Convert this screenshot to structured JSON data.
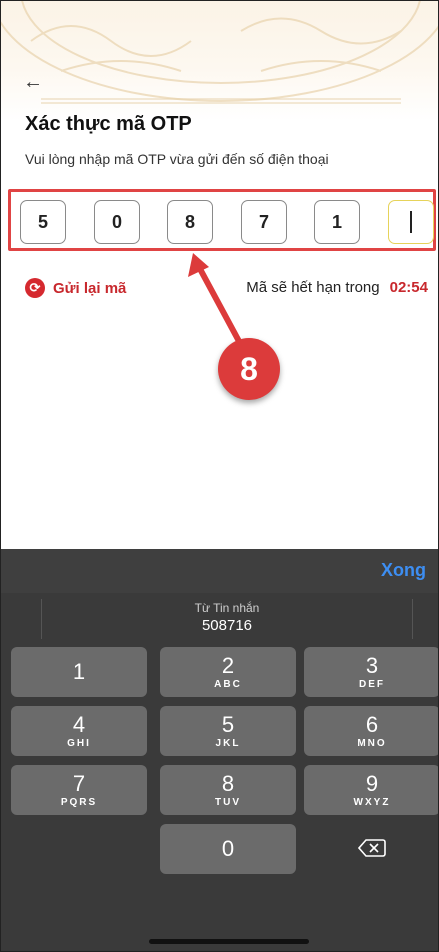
{
  "header": {
    "back_icon": "←",
    "title": "Xác thực mã OTP",
    "subtitle": "Vui lòng nhập mã OTP vừa gửi đến số điện thoại"
  },
  "otp": {
    "digits": [
      "5",
      "0",
      "8",
      "7",
      "1",
      ""
    ]
  },
  "actions": {
    "resend_label": "Gửi lại mã",
    "expire_text": "Mã sẽ hết hạn trong",
    "countdown": "02:54"
  },
  "annotation": {
    "step": "8"
  },
  "keyboard": {
    "done_label": "Xong",
    "suggestion_label": "Từ Tin nhắn",
    "suggestion_code": "508716",
    "keys": [
      {
        "digit": "1",
        "letters": ""
      },
      {
        "digit": "2",
        "letters": "ABC"
      },
      {
        "digit": "3",
        "letters": "DEF"
      },
      {
        "digit": "4",
        "letters": "GHI"
      },
      {
        "digit": "5",
        "letters": "JKL"
      },
      {
        "digit": "6",
        "letters": "MNO"
      },
      {
        "digit": "7",
        "letters": "PQRS"
      },
      {
        "digit": "8",
        "letters": "TUV"
      },
      {
        "digit": "9",
        "letters": "WXYZ"
      },
      {
        "digit": "0",
        "letters": ""
      }
    ]
  },
  "colors": {
    "accent_red": "#c8282d",
    "keyboard_bg": "#3a3a3a",
    "key_bg": "#6b6b6b",
    "done_blue": "#3d8ef2"
  }
}
